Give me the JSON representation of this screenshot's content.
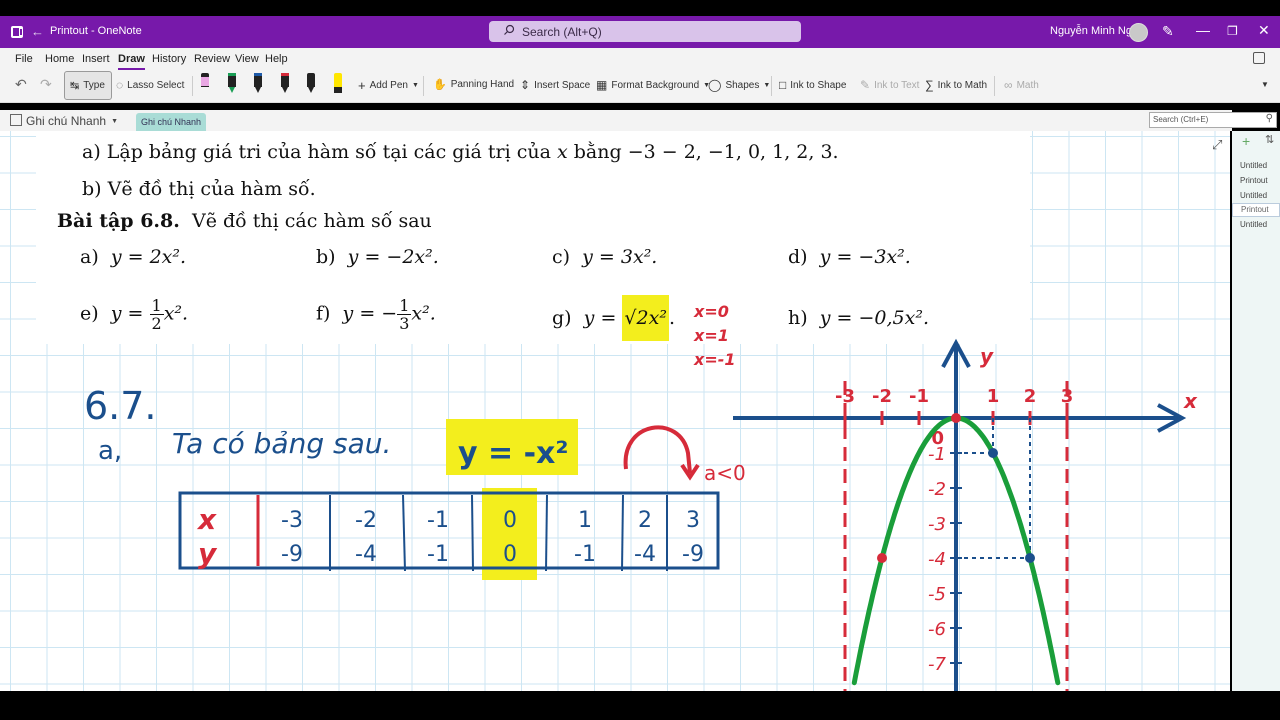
{
  "titlebar": {
    "app_title": "Printout  -  OneNote",
    "search_placeholder": "Search (Alt+Q)",
    "user_name": "Nguyễn Minh Nghĩa",
    "icons": [
      "onenote-icon",
      "back-icon",
      "search-icon",
      "avatar",
      "pen-icon",
      "minimize-icon",
      "restore-icon",
      "close-icon"
    ]
  },
  "menu": {
    "tabs": [
      "File",
      "Home",
      "Insert",
      "Draw",
      "History",
      "Review",
      "View",
      "Help"
    ],
    "active": "Draw"
  },
  "ribbon": {
    "type_label": "Type",
    "lasso_label": "Lasso Select",
    "add_pen_label": "Add Pen",
    "panning_label": "Panning Hand",
    "insert_space_label": "Insert Space",
    "format_bg_label": "Format Background",
    "shapes_label": "Shapes",
    "ink_shape_label": "Ink to Shape",
    "ink_text_label": "Ink to Text",
    "ink_math_label": "Ink to Math",
    "math_label": "Math",
    "pen_colors": [
      "#e9a7e3",
      "#1a9e55",
      "#1e5aa8",
      "#d62b3a",
      "#111111",
      "#ffe600"
    ]
  },
  "notebook": {
    "name": "Ghi chú Nhanh",
    "section_tab": "Ghi chú Nhanh",
    "search_placeholder": "Search (Ctrl+E)"
  },
  "pages": [
    "Untitled",
    "Printout",
    "Untitled",
    "Printout",
    "Untitled"
  ],
  "selected_page_index": 3,
  "printout": {
    "line_a_prefix": "a)  Lập bảng giá tri của hàm số tại các giá trị của ",
    "line_a_var": "x",
    "line_a_suffix": " bằng −3 − 2, −1, 0, 1, 2, 3.",
    "line_b": "b)  Vẽ đồ thị của hàm số.",
    "exercise_title": "Bài tập 6.8.",
    "exercise_text": "Vẽ đồ thị các hàm số sau",
    "items": [
      {
        "label": "a)",
        "expr": "y = 2x²."
      },
      {
        "label": "b)",
        "expr": "y = −2x²."
      },
      {
        "label": "c)",
        "expr": "y = 3x²."
      },
      {
        "label": "d)",
        "expr": "y = −3x²."
      },
      {
        "label": "e)",
        "prefix": "y = ",
        "num": "1",
        "den": "2",
        "suffix": "x²."
      },
      {
        "label": "f)",
        "prefix": "y = −",
        "num": "1",
        "den": "3",
        "suffix": "x²."
      },
      {
        "label": "g)",
        "prefix": "y = ",
        "highlighted": "√2x²",
        "suffix": "."
      },
      {
        "label": "h)",
        "expr": "y = −0,5x²."
      }
    ]
  },
  "handwriting": {
    "red_notes": [
      "x=0",
      "x=1",
      "x=-1"
    ],
    "heading": "6.7.",
    "part_a": "a,",
    "sentence": "Ta có bảng sau.",
    "equation": "y = -x²",
    "note_a": "a<0",
    "table_x_label": "x",
    "table_y_label": "y",
    "table_x": [
      "-3",
      "-2",
      "-1",
      "0",
      "1",
      "2",
      "3"
    ],
    "table_y": [
      "-9",
      "-4",
      "-1",
      "0",
      "-1",
      "-4",
      "-9"
    ],
    "axis_x_label": "x",
    "axis_y_label": "y",
    "x_ticks": [
      "-3",
      "-2",
      "-1",
      "1",
      "2",
      "3"
    ],
    "origin_label": "0",
    "y_ticks": [
      "-1",
      "-2",
      "-3",
      "-4",
      "-5",
      "-6",
      "-7"
    ],
    "colors": {
      "blue": "#1b4f8c",
      "red": "#d62b3a",
      "green": "#1a9e3a",
      "yellow": "#f3ee1d"
    }
  }
}
